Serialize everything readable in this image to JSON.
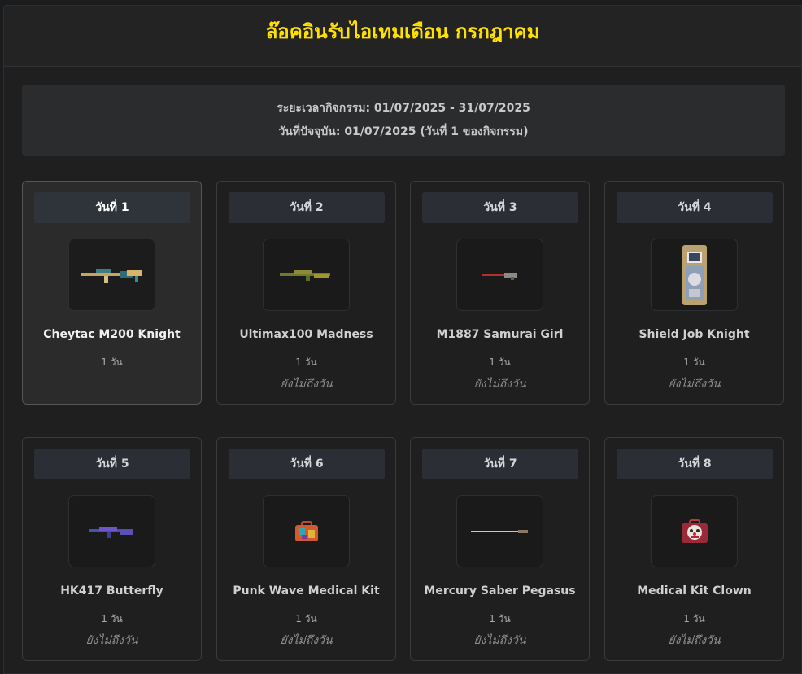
{
  "header": {
    "title": "ล๊อคอินรับไอเทมเดือน กรกฎาคม"
  },
  "info": {
    "period": "ระยะเวลากิจกรรม: 01/07/2025 - 31/07/2025",
    "today": "วันที่ปัจจุบัน: 01/07/2025 (วันที่ 1 ของกิจกรรม)"
  },
  "colors": {
    "title": "#ffe000",
    "background": "#1f1f20",
    "card_border": "#3a3b3e"
  },
  "cards": [
    {
      "day": "วันที่ 1",
      "name": "Cheytac M200 Knight",
      "duration": "1 วัน",
      "status": "",
      "icon": "sniper-rifle-icon"
    },
    {
      "day": "วันที่ 2",
      "name": "Ultimax100 Madness",
      "duration": "1 วัน",
      "status": "ยังไม่ถึงวัน",
      "icon": "machine-gun-icon"
    },
    {
      "day": "วันที่ 3",
      "name": "M1887 Samurai Girl",
      "duration": "1 วัน",
      "status": "ยังไม่ถึงวัน",
      "icon": "shotgun-icon"
    },
    {
      "day": "วันที่ 4",
      "name": "Shield Job Knight",
      "duration": "1 วัน",
      "status": "ยังไม่ถึงวัน",
      "icon": "shield-icon"
    },
    {
      "day": "วันที่ 5",
      "name": "HK417 Butterfly",
      "duration": "1 วัน",
      "status": "ยังไม่ถึงวัน",
      "icon": "assault-rifle-icon"
    },
    {
      "day": "วันที่ 6",
      "name": "Punk Wave Medical Kit",
      "duration": "1 วัน",
      "status": "ยังไม่ถึงวัน",
      "icon": "medical-kit-icon"
    },
    {
      "day": "วันที่ 7",
      "name": "Mercury Saber Pegasus",
      "duration": "1 วัน",
      "status": "ยังไม่ถึงวัน",
      "icon": "saber-icon"
    },
    {
      "day": "วันที่ 8",
      "name": "Medical Kit Clown",
      "duration": "1 วัน",
      "status": "ยังไม่ถึงวัน",
      "icon": "clown-medical-kit-icon"
    }
  ]
}
